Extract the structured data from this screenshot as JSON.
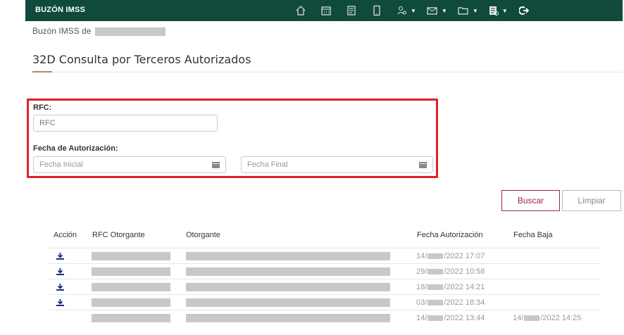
{
  "header": {
    "brand": "BUZÓN IMSS",
    "nav_icons": [
      "home-icon",
      "calendar-icon",
      "document-icon",
      "mobile-icon",
      "person-search-icon",
      "mail-icon",
      "folder-icon",
      "report-icon",
      "logout-icon"
    ]
  },
  "breadcrumb": {
    "prefix": "Buzón IMSS de"
  },
  "page": {
    "title": "32D Consulta por Terceros Autorizados"
  },
  "form": {
    "rfc_label": "RFC:",
    "rfc_placeholder": "RFC",
    "fecha_label": "Fecha de Autorización:",
    "fecha_inicial_placeholder": "Fecha Inicial",
    "fecha_final_placeholder": "Fecha Final"
  },
  "buttons": {
    "buscar": "Buscar",
    "limpiar": "Limpiar"
  },
  "table": {
    "headers": {
      "accion": "Acción",
      "rfc": "RFC Otorgante",
      "otorgante": "Otorgante",
      "fecha_aut": "Fecha Autorización",
      "fecha_baja": "Fecha Baja"
    },
    "rows": [
      {
        "aut_day": "14/",
        "aut_rest": "/2022 17:07",
        "has_download": true
      },
      {
        "aut_day": "29/",
        "aut_rest": "/2022 10:58",
        "has_download": true
      },
      {
        "aut_day": "18/",
        "aut_rest": "/2022 14:21",
        "has_download": true
      },
      {
        "aut_day": "03/",
        "aut_rest": "/2022 18:34",
        "has_download": true
      },
      {
        "aut_day": "14/",
        "aut_rest": "/2022 13:44",
        "baja_day": "14/",
        "baja_rest": "/2022 14:25",
        "has_download": false
      }
    ]
  },
  "colors": {
    "header_bg": "#0f4a3c",
    "accent": "#9d2449",
    "highlight": "#e41f2d",
    "download_icon": "#1e2a8c"
  }
}
